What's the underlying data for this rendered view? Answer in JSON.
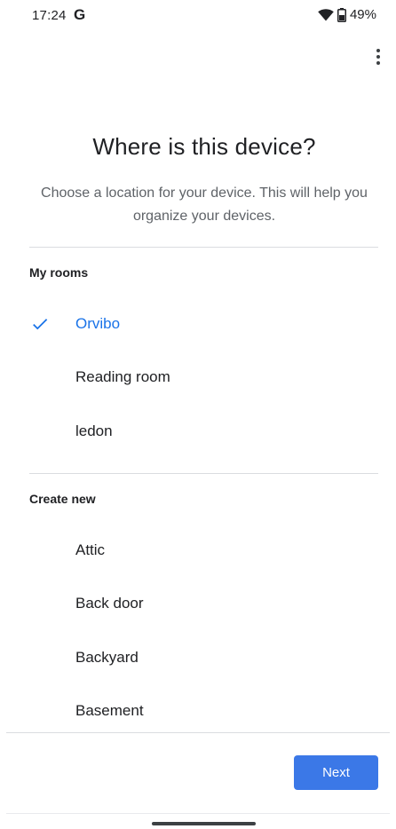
{
  "status_bar": {
    "time": "17:24",
    "google_glyph": "G",
    "battery": "49%",
    "icons": [
      "wifi-icon",
      "battery-icon"
    ]
  },
  "header": {
    "title": "Where is this device?",
    "subtitle": "Choose a location for your device. This will help you organize your devices."
  },
  "my_rooms": {
    "label": "My rooms",
    "items": [
      {
        "label": "Orvibo",
        "selected": true
      },
      {
        "label": "Reading room",
        "selected": false
      },
      {
        "label": "ledon",
        "selected": false
      }
    ]
  },
  "create_new": {
    "label": "Create new",
    "items": [
      {
        "label": "Attic"
      },
      {
        "label": "Back door"
      },
      {
        "label": "Backyard"
      },
      {
        "label": "Basement"
      }
    ]
  },
  "footer": {
    "next_label": "Next"
  },
  "colors": {
    "accent": "#1a73e8",
    "button": "#3b78e7",
    "divider": "#dadce0",
    "subtitle": "#5f6368"
  }
}
